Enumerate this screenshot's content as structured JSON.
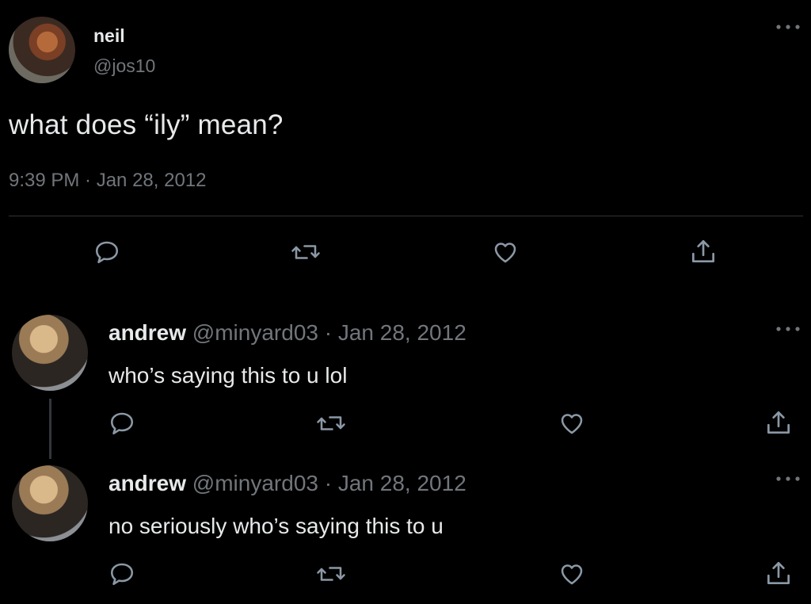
{
  "tweet": {
    "display_name": "neil",
    "handle": "@jos10",
    "text": "what does “ily” mean?",
    "timestamp": "9:39 PM · Jan 28, 2012"
  },
  "actions": [
    "reply-icon",
    "retweet-icon",
    "like-icon",
    "share-icon"
  ],
  "replies": [
    {
      "name": "andrew",
      "meta": " @minyard03 · Jan 28, 2012",
      "text": "who’s saying this to u lol"
    },
    {
      "name": "andrew",
      "meta": " @minyard03 · Jan 28, 2012",
      "text": "no seriously who’s saying this to u"
    }
  ],
  "colors": {
    "background": "#000000",
    "text": "#e7e9ea",
    "secondary": "#71767b",
    "divider": "#2f3336"
  }
}
